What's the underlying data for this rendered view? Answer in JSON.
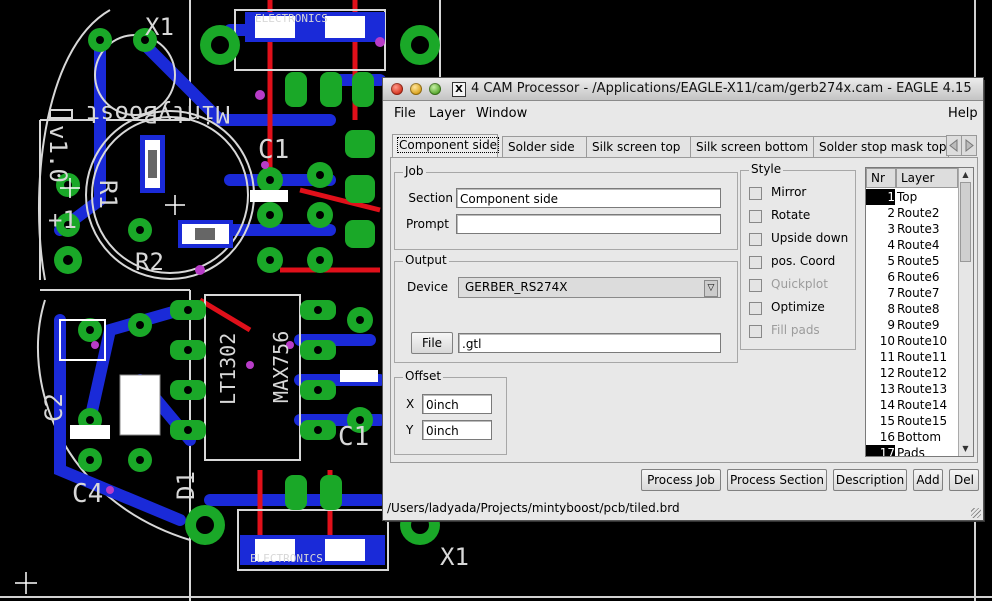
{
  "window": {
    "title": "4 CAM Processor - /Applications/EAGLE-X11/cam/gerb274x.cam - EAGLE 4.15",
    "x11_badge": "X"
  },
  "menu": {
    "file": "File",
    "layer": "Layer",
    "window": "Window",
    "help": "Help"
  },
  "tabs": [
    "Component side",
    "Solder side",
    "Silk screen top",
    "Silk screen bottom",
    "Solder stop mask top"
  ],
  "job": {
    "group_label": "Job",
    "section_label": "Section",
    "section_value": "Component side",
    "prompt_label": "Prompt",
    "prompt_value": ""
  },
  "output": {
    "group_label": "Output",
    "device_label": "Device",
    "device_value": "GERBER_RS274X",
    "file_button": "File",
    "file_value": ".gtl"
  },
  "offset": {
    "group_label": "Offset",
    "x_label": "X",
    "x_value": "0inch",
    "y_label": "Y",
    "y_value": "0inch"
  },
  "style": {
    "group_label": "Style",
    "options": [
      {
        "label": "Mirror",
        "enabled": true
      },
      {
        "label": "Rotate",
        "enabled": true
      },
      {
        "label": "Upside down",
        "enabled": true
      },
      {
        "label": "pos. Coord",
        "enabled": true
      },
      {
        "label": "Quickplot",
        "enabled": false
      },
      {
        "label": "Optimize",
        "enabled": true
      },
      {
        "label": "Fill pads",
        "enabled": false
      }
    ]
  },
  "layers": {
    "header_nr": "Nr",
    "header_layer": "Layer",
    "rows": [
      {
        "nr": "1",
        "name": "Top",
        "selected": true
      },
      {
        "nr": "2",
        "name": "Route2",
        "selected": false
      },
      {
        "nr": "3",
        "name": "Route3",
        "selected": false
      },
      {
        "nr": "4",
        "name": "Route4",
        "selected": false
      },
      {
        "nr": "5",
        "name": "Route5",
        "selected": false
      },
      {
        "nr": "6",
        "name": "Route6",
        "selected": false
      },
      {
        "nr": "7",
        "name": "Route7",
        "selected": false
      },
      {
        "nr": "8",
        "name": "Route8",
        "selected": false
      },
      {
        "nr": "9",
        "name": "Route9",
        "selected": false
      },
      {
        "nr": "10",
        "name": "Route10",
        "selected": false
      },
      {
        "nr": "11",
        "name": "Route11",
        "selected": false
      },
      {
        "nr": "12",
        "name": "Route12",
        "selected": false
      },
      {
        "nr": "13",
        "name": "Route13",
        "selected": false
      },
      {
        "nr": "14",
        "name": "Route14",
        "selected": false
      },
      {
        "nr": "15",
        "name": "Route15",
        "selected": false
      },
      {
        "nr": "16",
        "name": "Bottom",
        "selected": false
      },
      {
        "nr": "17",
        "name": "Pads",
        "selected": true
      }
    ]
  },
  "buttons": {
    "process_job": "Process Job",
    "process_section": "Process Section",
    "description": "Description",
    "add": "Add",
    "del": "Del"
  },
  "status": "/Users/ladyada/Projects/mintyboost/pcb/tiled.brd",
  "board_labels": {
    "x1_top": "X1",
    "x1_bottom": "X1",
    "c1_top": "C1",
    "c1_bottom": "C1",
    "c2": "C2",
    "c4": "C4",
    "d1": "D1",
    "r1": "R1",
    "r2": "R2",
    "plus1": "+1",
    "brand": "MintyBoost",
    "ver": "v1.0",
    "ic1": "LT1302",
    "ic2": "MAX756",
    "adafruit": "ELECTRONICS"
  },
  "colors": {
    "pad": "#1aa828",
    "trace_top": "#e0101a",
    "trace_bottom": "#1a2ad8",
    "silk": "#d8d8d8",
    "via": "#b83cc8"
  }
}
